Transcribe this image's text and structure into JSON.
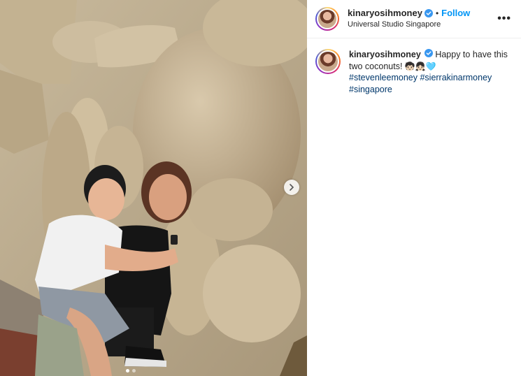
{
  "post": {
    "username": "kinaryosihmoney",
    "follow_label": "Follow",
    "separator": "•",
    "location": "Universal Studio Singapore",
    "more_label": "•••",
    "caption": {
      "text": "Happy to have this two coconuts!",
      "emojis": "🧒🏻👧🏻🩵",
      "hashtags": [
        "#stevenleemoney",
        "#sierrakinarmoney",
        "#singapore"
      ]
    },
    "carousel": {
      "slides": 2,
      "active_index": 0
    }
  },
  "colors": {
    "link_blue": "#0095f6",
    "hashtag": "#00376b",
    "verified": "#3897f0"
  }
}
